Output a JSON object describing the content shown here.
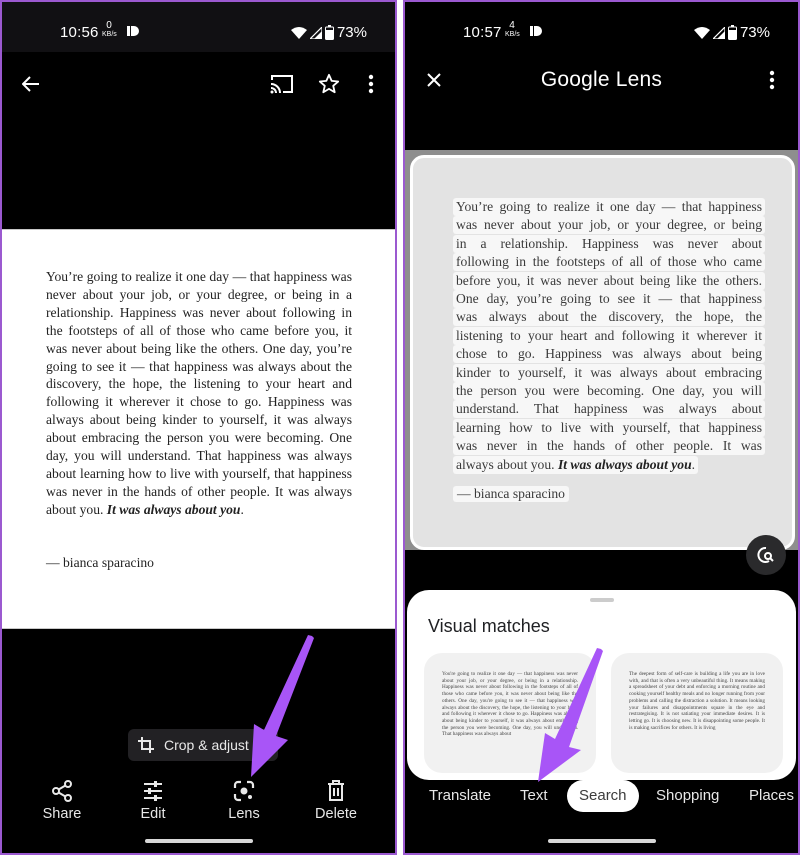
{
  "colors": {
    "arrow": "#a855f7",
    "frame_border": "#9b59d0"
  },
  "left": {
    "status": {
      "time": "10:56",
      "net_value": "0",
      "net_unit": "KB/s",
      "battery": "73%"
    },
    "topbar": {
      "back_icon": "arrow-left-icon",
      "cast_icon": "cast-icon",
      "star_icon": "star-icon",
      "more_icon": "more-vert-icon"
    },
    "photo": {
      "quote": "You’re going to realize it one day  — that happiness was never about your job, or your degree, or being in a relationship. Happiness was never about following in the footsteps of all of those who came before you, it was never about being like the others. One day, you’re going to see it — that happiness was always about the discovery, the hope, the listening to your heart and following it wherever it chose to go. Happiness was always about being kinder to yourself, it was always about embracing the person you were becoming. One day, you will understand. That happiness was always about learning how to live with yourself, that happiness was never in the hands of other people. It was always about you.",
      "emphasis": "It was always about you",
      "end": ".",
      "author": "— bianca sparacino"
    },
    "crop_chip": {
      "label": "Crop & adjust",
      "icon": "crop-icon"
    },
    "actions": [
      {
        "label": "Share",
        "icon": "share-icon"
      },
      {
        "label": "Edit",
        "icon": "tune-icon"
      },
      {
        "label": "Lens",
        "icon": "lens-icon"
      },
      {
        "label": "Delete",
        "icon": "trash-icon"
      }
    ]
  },
  "right": {
    "status": {
      "time": "10:57",
      "net_value": "4",
      "net_unit": "KB/s",
      "battery": "73%"
    },
    "topbar": {
      "title": "Google Lens",
      "close_icon": "close-icon",
      "more_icon": "more-vert-icon"
    },
    "lens_lines": [
      "You’re going to realize it one day  — that happiness",
      "was never about your job, or your degree, or being",
      "in a relationship. Happiness was never about",
      "following in the footsteps of all of those who came",
      "before you, it was never about being like the others.",
      "One day, you’re going to see it — that happiness",
      "was always about the discovery, the hope, the",
      "listening to your heart and following it wherever it",
      "chose to go. Happiness was always about being",
      "kinder to yourself, it was always about embracing",
      "the person you were becoming. One day, you will",
      "understand. That happiness was always about",
      "learning how to live with yourself, that happiness",
      "was never in the hands of other people. It was"
    ],
    "lens_last_line": {
      "plain": "always about you. ",
      "emphasis": "It was always about you",
      "end": "."
    },
    "lens_author": "— bianca sparacino",
    "fab_icon": "lens-search-icon",
    "sheet": {
      "title": "Visual matches",
      "cards": [
        {
          "text": "You're going to realize it one day — that happiness was never about your job, or your degree, or being in a relationship. Happiness was never about following in the footsteps of all of those who came before you, it was never about being like the others. One day, you're going to see it — that happiness was always about the discovery, the hope, the listening to your heart and following it wherever it chose to go. Happiness was always about being kinder to yourself, it was always about embracing the person you were becoming. One day, you will understand. That happiness was always about"
        },
        {
          "text": "The deepest form of self-care is building a life you are in love with, and that is often a very unbeautiful thing. It means making a spreadsheet of your debt and enforcing a morning routine and cooking yourself healthy meals and no longer running from your problems and calling the distraction a solution. It means looking your failures and disappointments square in the eye and restrategising. It is not satiating your immediate desires. It is letting go. It is choosing new. It is disappointing some people. It is making sacrifices for others. It is living"
        }
      ]
    },
    "tabs": [
      {
        "label": "Translate",
        "active": false
      },
      {
        "label": "Text",
        "active": false
      },
      {
        "label": "Search",
        "active": true
      },
      {
        "label": "Shopping",
        "active": false
      },
      {
        "label": "Places",
        "active": false
      }
    ]
  }
}
